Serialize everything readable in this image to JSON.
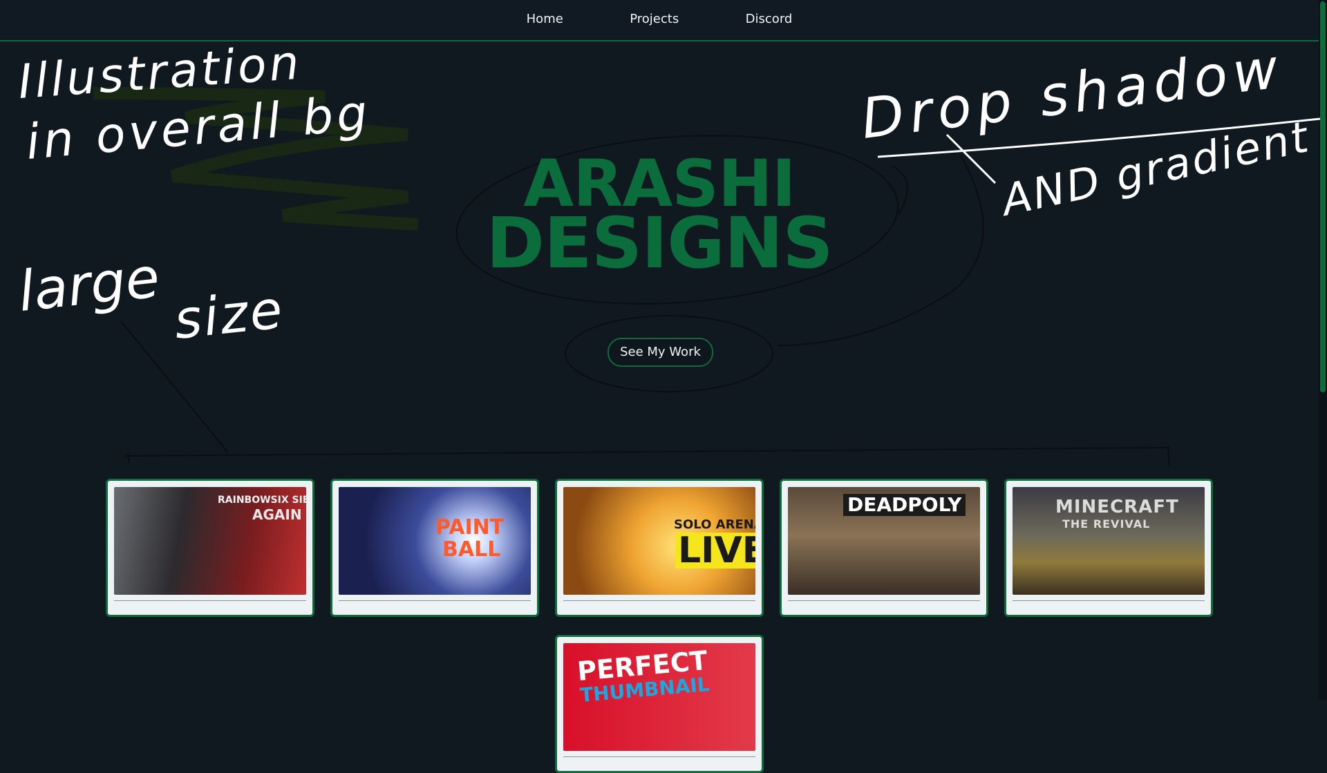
{
  "nav": {
    "items": [
      "Home",
      "Projects",
      "Discord"
    ]
  },
  "hero": {
    "title_line1": "ARASHI",
    "title_line2": "DESIGNS",
    "cta_label": "See My Work"
  },
  "annotations": {
    "note1_line1": "Illustration",
    "note1_line2": "in overall bg",
    "note2_line1": "large",
    "note2_line2": "size",
    "note3_line1": "Drop shadow",
    "note3_line2": "AND gradient"
  },
  "projects": [
    {
      "title_a": "RAINBOWSIX SIEGE",
      "title_b": "AGAIN"
    },
    {
      "title_a": "PAINT",
      "title_b": "BALL"
    },
    {
      "title_a": "SOLO ARENA",
      "title_b": "LIVE"
    },
    {
      "title_a": "DEADPOLY",
      "title_b": ""
    },
    {
      "title_a": "MINECRAFT",
      "title_b": "THE REVIVAL"
    },
    {
      "title_a": "PERFECT",
      "title_b": "THUMBNAIL"
    }
  ],
  "colors": {
    "background": "#101820",
    "accent_green": "#0f6b3a",
    "title_green": "#0a6d3b",
    "card_bg": "#edf3f5"
  }
}
